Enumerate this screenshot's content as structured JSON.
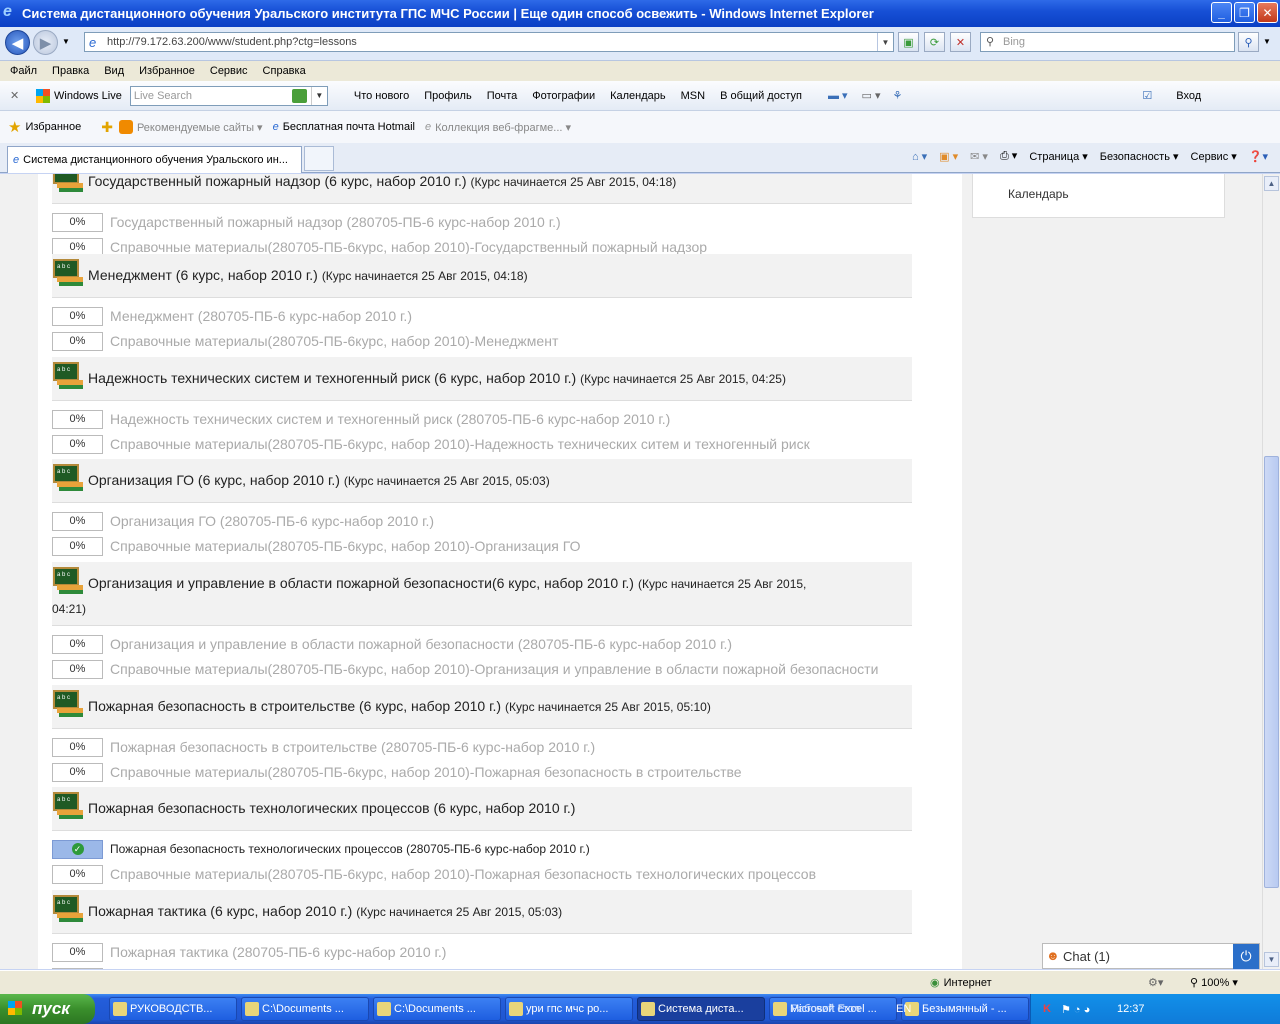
{
  "window": {
    "title": "Система дистанционного обучения Уральского института ГПС МЧС России | Еще один способ освежить  - Windows Internet Explorer"
  },
  "address": {
    "url": "http://79.172.63.200/www/student.php?ctg=lessons",
    "search_placeholder": "Bing"
  },
  "menu": [
    "Файл",
    "Правка",
    "Вид",
    "Избранное",
    "Сервис",
    "Справка"
  ],
  "wl_toolbar": {
    "brand": "Windows Live",
    "search_placeholder": "Live Search",
    "links": [
      "Что нового",
      "Профиль",
      "Почта",
      "Фотографии",
      "Календарь",
      "MSN",
      "В общий доступ"
    ],
    "signin": "Вход"
  },
  "favorites": {
    "label": "Избранное",
    "items": [
      "Рекомендуемые сайты ▾",
      "Бесплатная почта Hotmail",
      "Коллекция веб-фрагме... ▾"
    ]
  },
  "tab": {
    "title": "Система дистанционного обучения Уральского ин..."
  },
  "command_bar": [
    "Страница ▾",
    "Безопасность ▾",
    "Сервис ▾"
  ],
  "right_panel": {
    "calendar_label": "Календарь"
  },
  "courses": [
    {
      "title": "Государственный пожарный надзор (6 курс, набор 2010 г.)",
      "meta": "(Курс начинается 25 Авг 2015, 04:18)",
      "activities": [
        {
          "pct": "0%",
          "name": "Государственный пожарный надзор (280705-ПБ-6 курс-набор 2010 г.)"
        },
        {
          "pct": "0%",
          "name": "Справочные материалы(280705-ПБ-6курс, набор 2010)-Государственный пожарный надзор"
        }
      ]
    },
    {
      "title": "Менеджмент (6 курс, набор 2010 г.)",
      "meta": "(Курс начинается 25 Авг 2015, 04:18)",
      "activities": [
        {
          "pct": "0%",
          "name": "Менеджмент (280705-ПБ-6 курс-набор 2010 г.)"
        },
        {
          "pct": "0%",
          "name": "Справочные материалы(280705-ПБ-6курс, набор 2010)-Менеджмент"
        }
      ]
    },
    {
      "title": "Надежность технических систем и техногенный риск (6 курс, набор 2010 г.)",
      "meta": "(Курс начинается 25 Авг 2015, 04:25)",
      "activities": [
        {
          "pct": "0%",
          "name": "Надежность технических систем и техногенный риск (280705-ПБ-6 курс-набор 2010 г.)"
        },
        {
          "pct": "0%",
          "name": "Справочные материалы(280705-ПБ-6курс, набор 2010)-Надежность технических ситем и техногенный риск"
        }
      ]
    },
    {
      "title": "Организация ГО (6 курс, набор 2010 г.)",
      "meta": "(Курс начинается 25 Авг 2015, 05:03)",
      "activities": [
        {
          "pct": "0%",
          "name": "Организация ГО (280705-ПБ-6 курс-набор 2010 г.)"
        },
        {
          "pct": "0%",
          "name": "Справочные материалы(280705-ПБ-6курс, набор 2010)-Организация ГО"
        }
      ]
    },
    {
      "title": "Организация и управление в области пожарной безопасности(6 курс, набор 2010 г.)",
      "meta": "(Курс начинается 25 Авг 2015,",
      "meta2": "04:21)",
      "activities": [
        {
          "pct": "0%",
          "name": "Организация и управление в области пожарной безопасности (280705-ПБ-6 курс-набор 2010 г.)"
        },
        {
          "pct": "0%",
          "name": "Справочные материалы(280705-ПБ-6курс, набор 2010)-Организация и управление в области пожарной безопасности"
        }
      ]
    },
    {
      "title": "Пожарная безопасность в строительстве (6 курс, набор 2010 г.)",
      "meta": "(Курс начинается 25 Авг 2015, 05:10)",
      "activities": [
        {
          "pct": "0%",
          "name": "Пожарная безопасность в строительстве (280705-ПБ-6 курс-набор 2010 г.)"
        },
        {
          "pct": "0%",
          "name": "Справочные материалы(280705-ПБ-6курс, набор 2010)-Пожарная безопасность в строительстве"
        }
      ]
    },
    {
      "title": "Пожарная безопасность технологических процессов (6 курс, набор 2010 г.)",
      "meta": "",
      "activities": [
        {
          "pct": "",
          "done": true,
          "name": "Пожарная безопасность технологических процессов (280705-ПБ-6 курс-набор 2010 г.)"
        },
        {
          "pct": "0%",
          "name": "Справочные материалы(280705-ПБ-6курс, набор 2010)-Пожарная безопасность технологических процессов"
        }
      ]
    },
    {
      "title": "Пожарная тактика (6 курс, набор 2010 г.)",
      "meta": "(Курс начинается 25 Авг 2015, 05:03)",
      "activities": [
        {
          "pct": "0%",
          "name": "Пожарная тактика (280705-ПБ-6 курс-набор 2010 г.)"
        },
        {
          "pct": "",
          "name": ""
        }
      ]
    }
  ],
  "chat": {
    "label": "Chat (1)"
  },
  "status": {
    "zone": "Интернет",
    "zoom": "100%"
  },
  "taskbar": {
    "start": "пуск",
    "buttons": [
      "РУКОВОДСТВ...",
      "C:\\Documents ...",
      "C:\\Documents ...",
      "ури гпс мчс ро...",
      "Система диста...",
      "Microsoft Excel ...",
      "Безымянный - ..."
    ],
    "desktop": "Рабочий стол",
    "lang": "EN",
    "time": "12:37"
  }
}
